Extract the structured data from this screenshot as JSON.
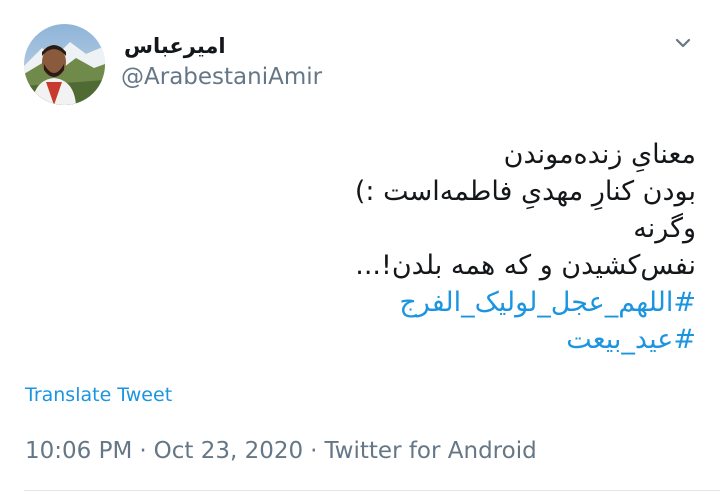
{
  "author": {
    "display_name": "امیرعباس",
    "username": "@ArabestaniAmir",
    "avatar_icon": "profile-photo"
  },
  "menu": {
    "icon": "chevron-down-icon"
  },
  "tweet": {
    "lines": [
      "معنایِ زنده‌موندن",
      "بودن کنارِ مهدیِ فاطمه‌است :)",
      "وگرنه",
      "نفس‌کشیدن و که همه بلدن!..."
    ],
    "hashtags": [
      "#اللهم_عجل_لولیک_الفرج",
      "#عید_بیعت"
    ]
  },
  "translate_label": "Translate Tweet",
  "meta": {
    "time": "10:06 PM",
    "date": "Oct 23, 2020",
    "source": "Twitter for Android",
    "separator": "·"
  },
  "colors": {
    "link": "#1b95e0",
    "secondary_text": "#657786",
    "primary_text": "#14171a"
  }
}
